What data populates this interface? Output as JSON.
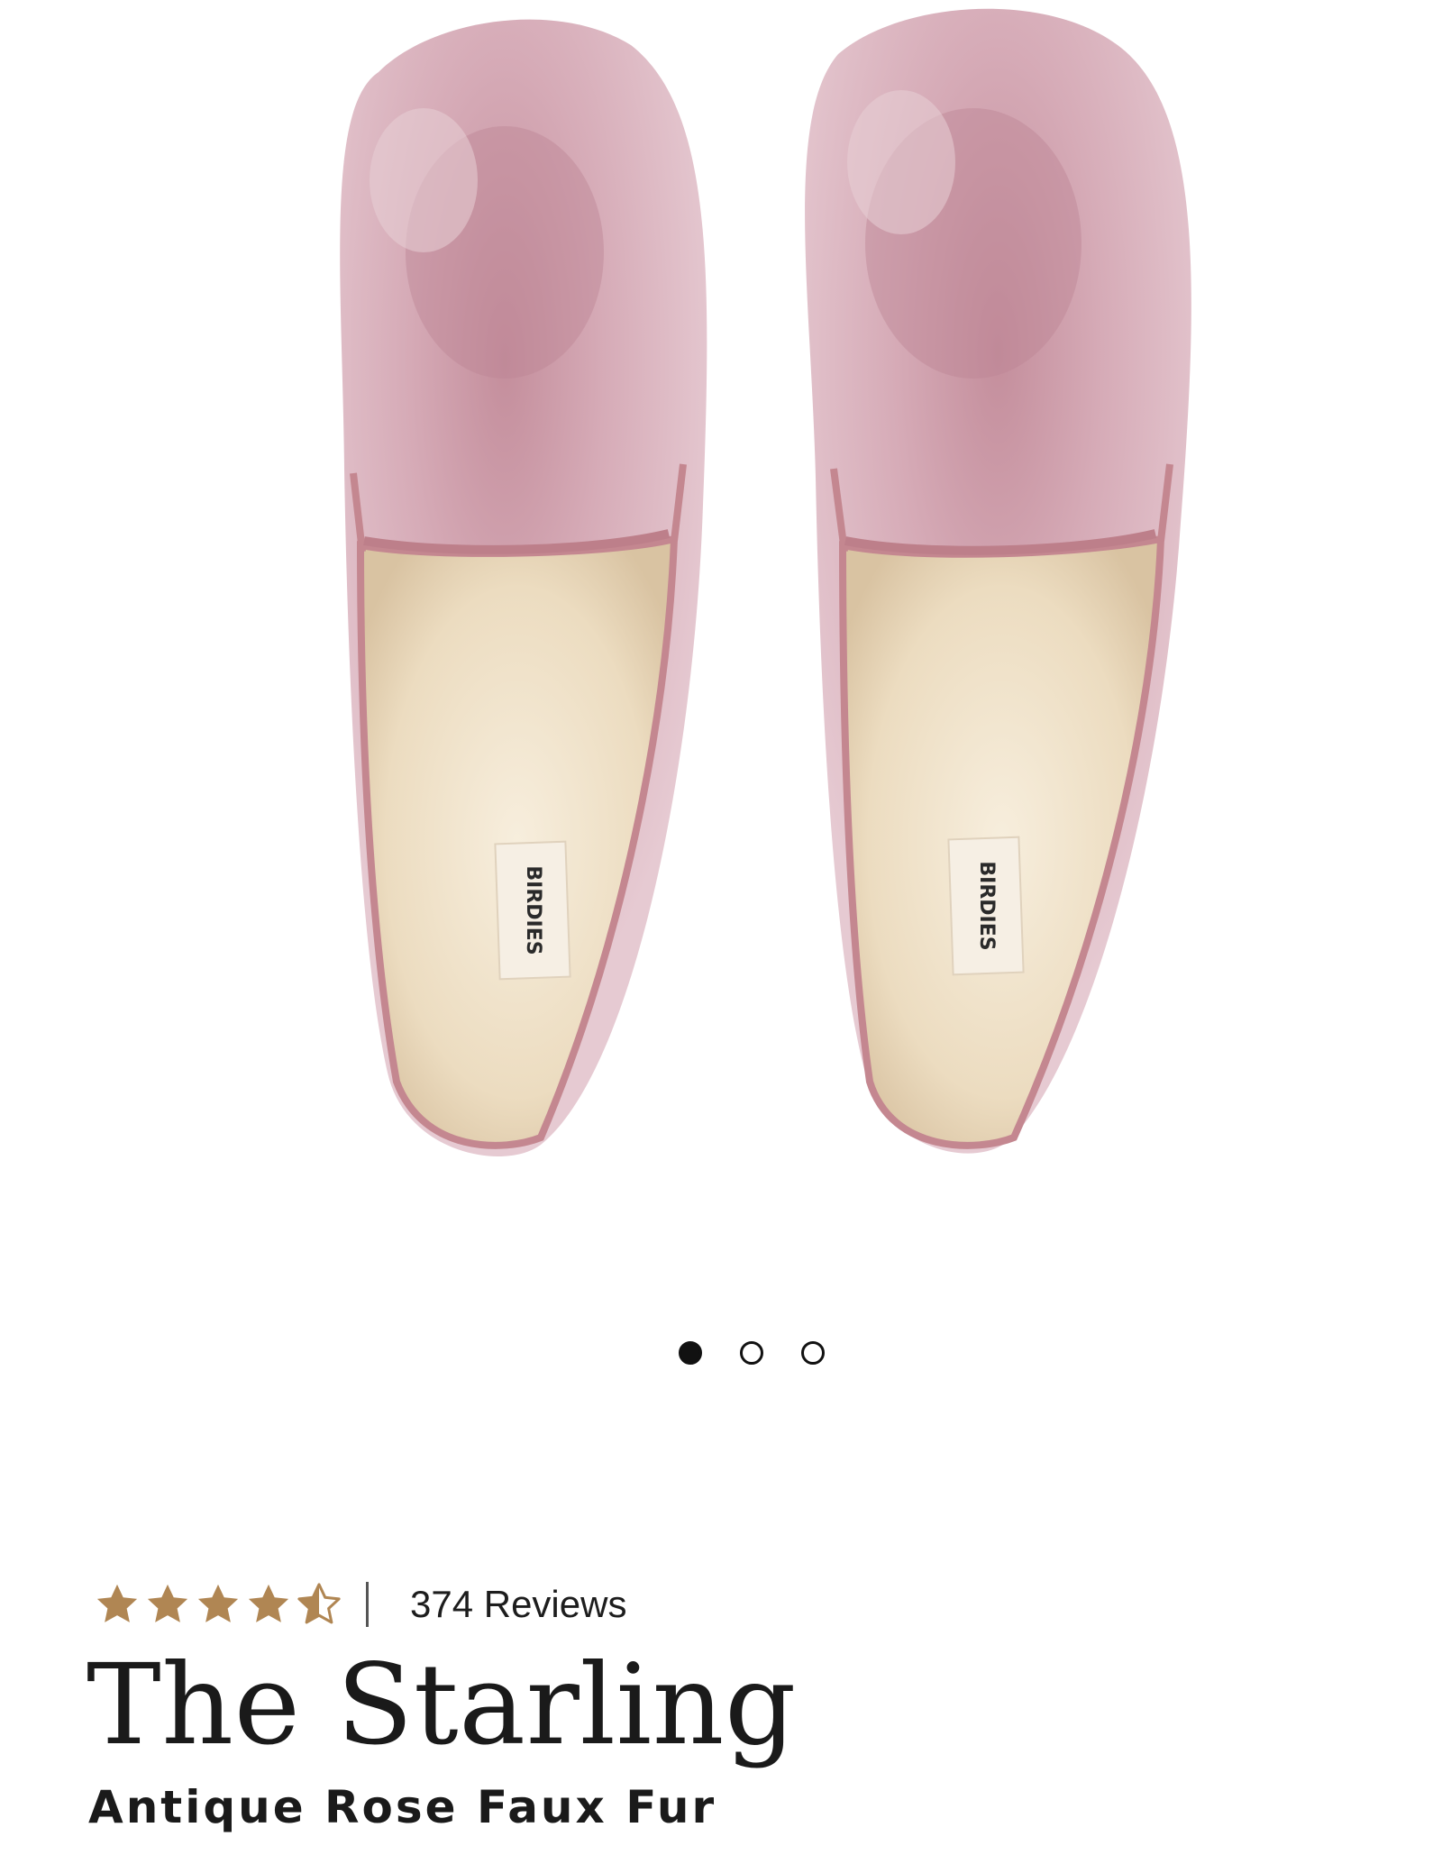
{
  "product": {
    "brand_label": "BIRDIES",
    "name": "The Starling",
    "variant": "Antique Rose Faux Fur",
    "rating": 4.5,
    "rating_max": 5,
    "reviews_label": "374 Reviews"
  },
  "carousel": {
    "dot_count": 3,
    "active_index": 0
  },
  "colors": {
    "star": "#b08653",
    "velvet": "#d9b2bd",
    "velvet_dark": "#b98593",
    "piping": "#c48790",
    "fur": "#f0e3cc",
    "text": "#1a1a1a"
  },
  "icons": {
    "star_full": "star-icon",
    "star_half": "star-half-icon"
  }
}
